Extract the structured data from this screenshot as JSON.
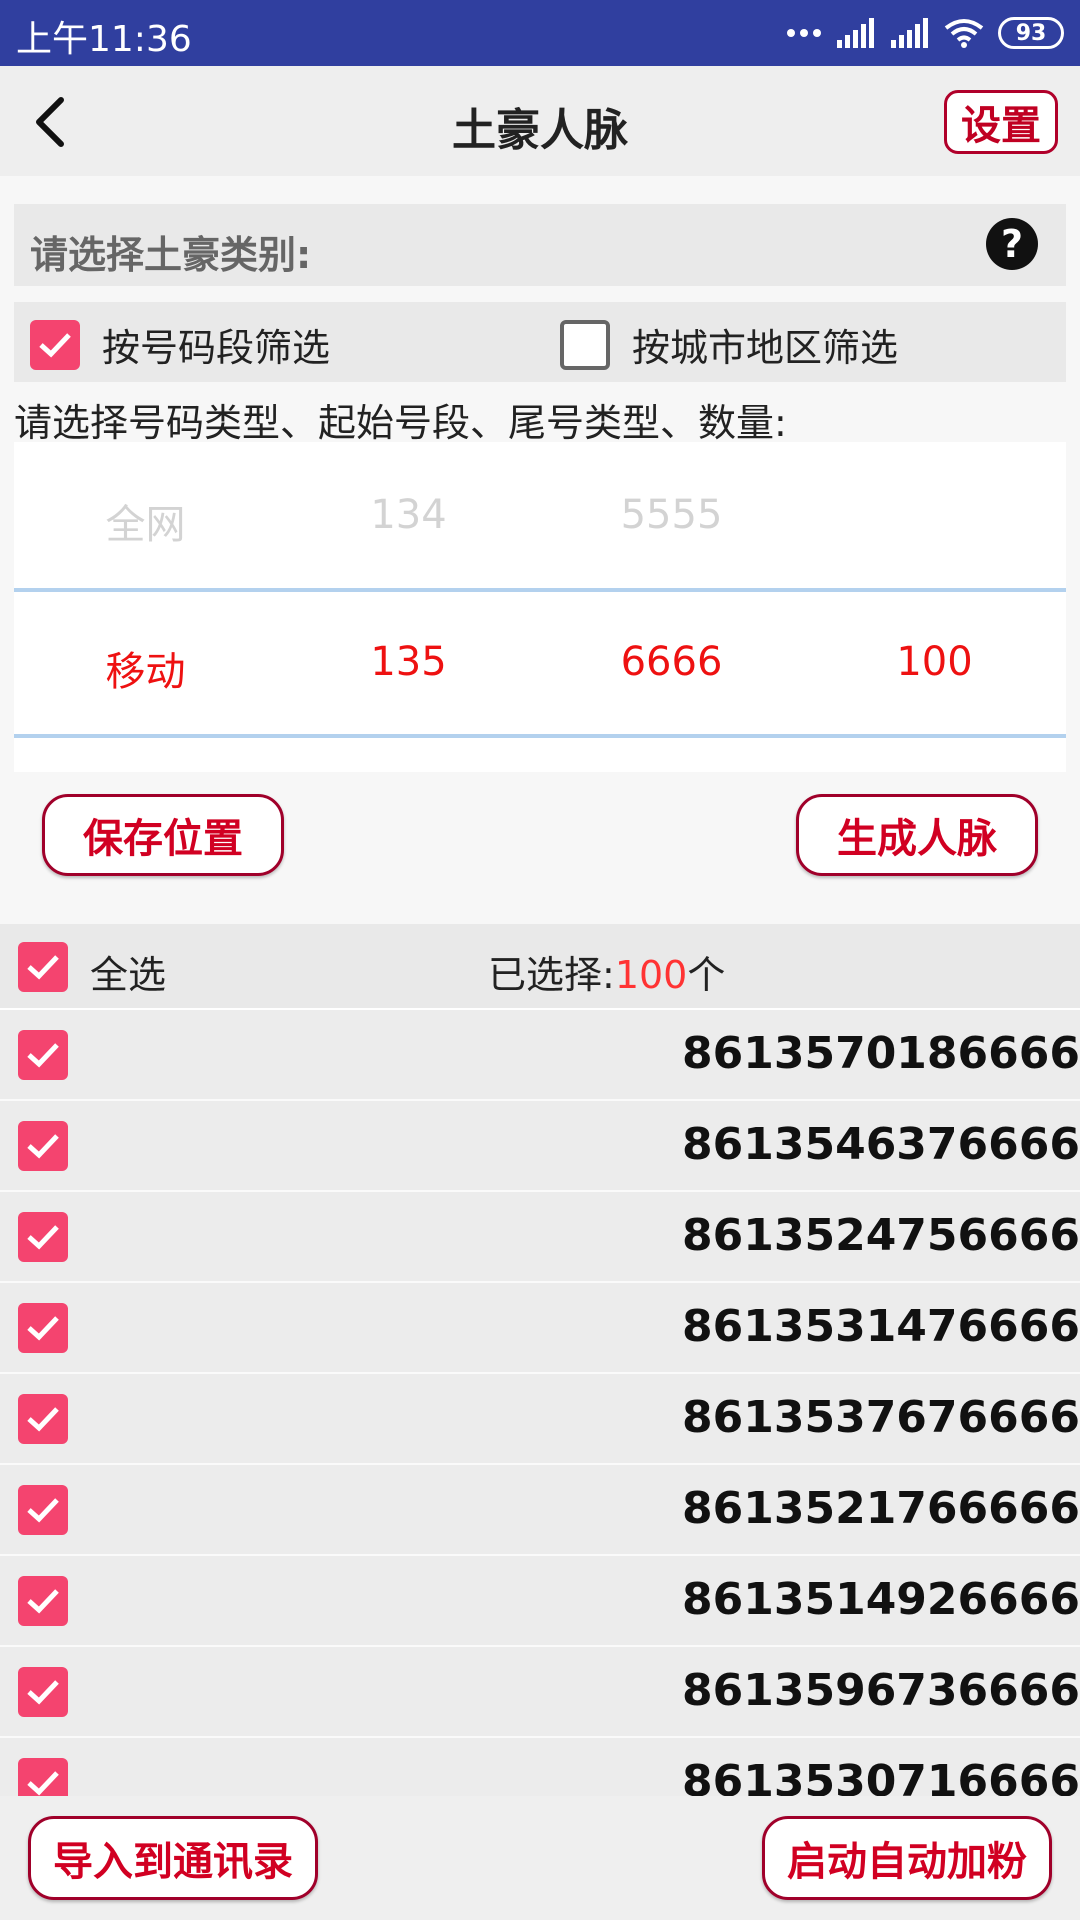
{
  "status_bar": {
    "time": "上午11:36",
    "battery": "93"
  },
  "app_bar": {
    "title": "土豪人脉",
    "settings_label": "设置"
  },
  "category": {
    "label": "请选择土豪类别:"
  },
  "filters": [
    {
      "label": "按号码段筛选",
      "checked": true
    },
    {
      "label": "按城市地区筛选",
      "checked": false
    }
  ],
  "instruction": "请选择号码类型、起始号段、尾号类型、数量:",
  "picker": {
    "faded_row": [
      "全网",
      "134",
      "5555",
      ""
    ],
    "selected_row": [
      "移动",
      "135",
      "6666",
      "100"
    ]
  },
  "actions": {
    "save_position": "保存位置",
    "generate": "生成人脉"
  },
  "select_all": {
    "label": "全选",
    "selected_prefix": "已选择:",
    "selected_count": "100",
    "selected_suffix": "个"
  },
  "phone_list": [
    "8613570186666",
    "8613546376666",
    "8613524756666",
    "8613531476666",
    "8613537676666",
    "8613521766666",
    "8613514926666",
    "8613596736666",
    "8613530716666"
  ],
  "bottom": {
    "import_label": "导入到通讯录",
    "auto_add_label": "启动自动加粉"
  },
  "colors": {
    "accent": "#f4446f",
    "status_bar": "#303f9f",
    "button_text": "#d10022",
    "picker_selected": "#ee1111"
  }
}
